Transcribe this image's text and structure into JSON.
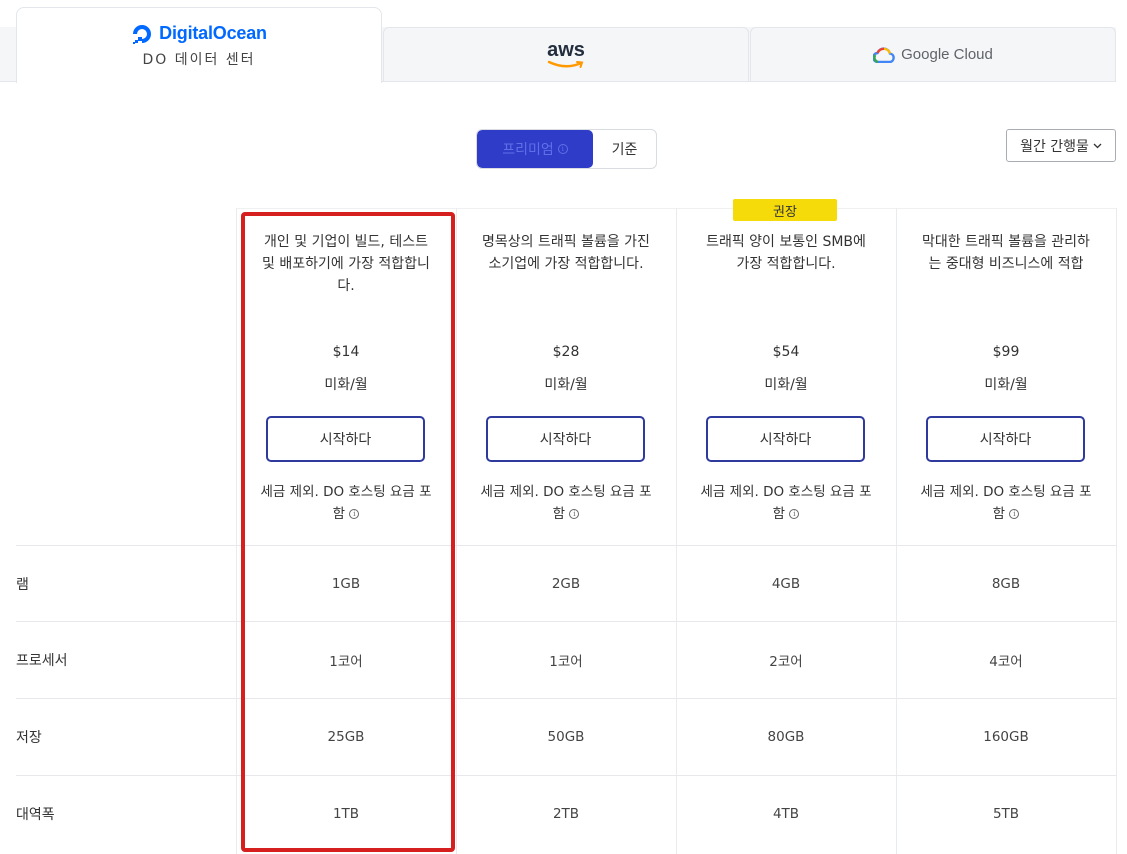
{
  "tabs": {
    "digitalocean": {
      "brand": "DigitalOcean",
      "subtitle": "DO 데이터 센터"
    },
    "aws": {
      "brand": "aws"
    },
    "google": {
      "brand": "Google Cloud"
    }
  },
  "toggle": {
    "premium_label": "프리미엄",
    "basic_label": "기준"
  },
  "period": {
    "label": "월간 간행물"
  },
  "badge": {
    "recommended": "권장"
  },
  "plans": [
    {
      "desc": "개인 및 기업이 빌드, 테스트 및 배포하기에 가장 적합합니다.",
      "price": "$14",
      "unit": "미화/월",
      "cta": "시작하다",
      "note": "세금 제외. DO 호스팅 요금 포함"
    },
    {
      "desc": "명목상의 트래픽 볼륨을 가진 소기업에 가장 적합합니다.",
      "price": "$28",
      "unit": "미화/월",
      "cta": "시작하다",
      "note": "세금 제외. DO 호스팅 요금 포함"
    },
    {
      "desc": "트래픽 양이 보통인 SMB에 가장 적합합니다.",
      "price": "$54",
      "unit": "미화/월",
      "cta": "시작하다",
      "note": "세금 제외. DO 호스팅 요금 포함"
    },
    {
      "desc": "막대한 트래픽 볼륨을 관리하는 중대형 비즈니스에 적합",
      "price": "$99",
      "unit": "미화/월",
      "cta": "시작하다",
      "note": "세금 제외. DO 호스팅 요금 포함"
    }
  ],
  "specs": [
    {
      "label": "램",
      "values": [
        "1GB",
        "2GB",
        "4GB",
        "8GB"
      ]
    },
    {
      "label": "프로세서",
      "values": [
        "1코어",
        "1코어",
        "2코어",
        "4코어"
      ]
    },
    {
      "label": "저장",
      "values": [
        "25GB",
        "50GB",
        "80GB",
        "160GB"
      ]
    },
    {
      "label": "대역폭",
      "values": [
        "1TB",
        "2TB",
        "4TB",
        "5TB"
      ]
    }
  ],
  "colors": {
    "accent": "#2e3cc7",
    "button_border": "#2e3a9c",
    "badge": "#f6db0b",
    "highlight": "#d61f1f",
    "do_blue": "#0069ff"
  }
}
